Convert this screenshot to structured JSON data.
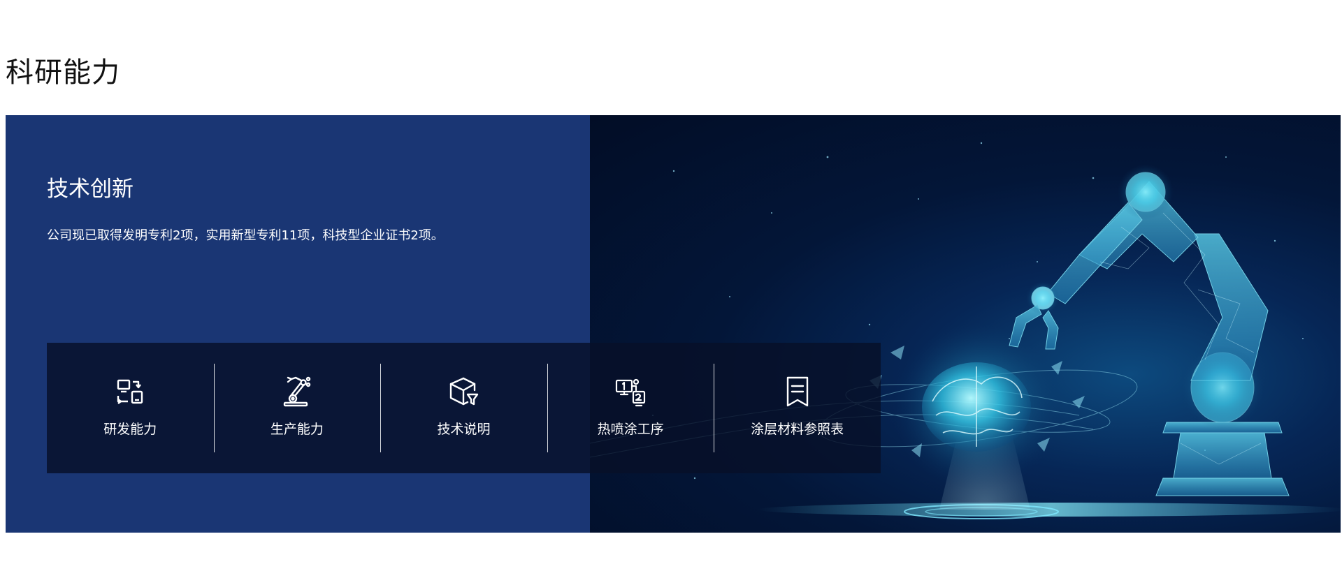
{
  "page": {
    "title": "科研能力"
  },
  "banner": {
    "heading": "技术创新",
    "description": "公司现已取得发明专利2项，实用新型专利11项，科技型企业证书2项。",
    "colors": {
      "left_panel": "#1a3674",
      "right_panel": "#031638",
      "nav_overlay": "#071028",
      "accent_glow": "#4fd8f0"
    }
  },
  "nav": {
    "items": [
      {
        "label": "研发能力",
        "icon": "devices-icon"
      },
      {
        "label": "生产能力",
        "icon": "robot-arm-icon"
      },
      {
        "label": "技术说明",
        "icon": "box-filter-icon"
      },
      {
        "label": "热喷涂工序",
        "icon": "process-steps-icon"
      },
      {
        "label": "涂层材料参照表",
        "icon": "bookmark-list-icon"
      }
    ]
  }
}
